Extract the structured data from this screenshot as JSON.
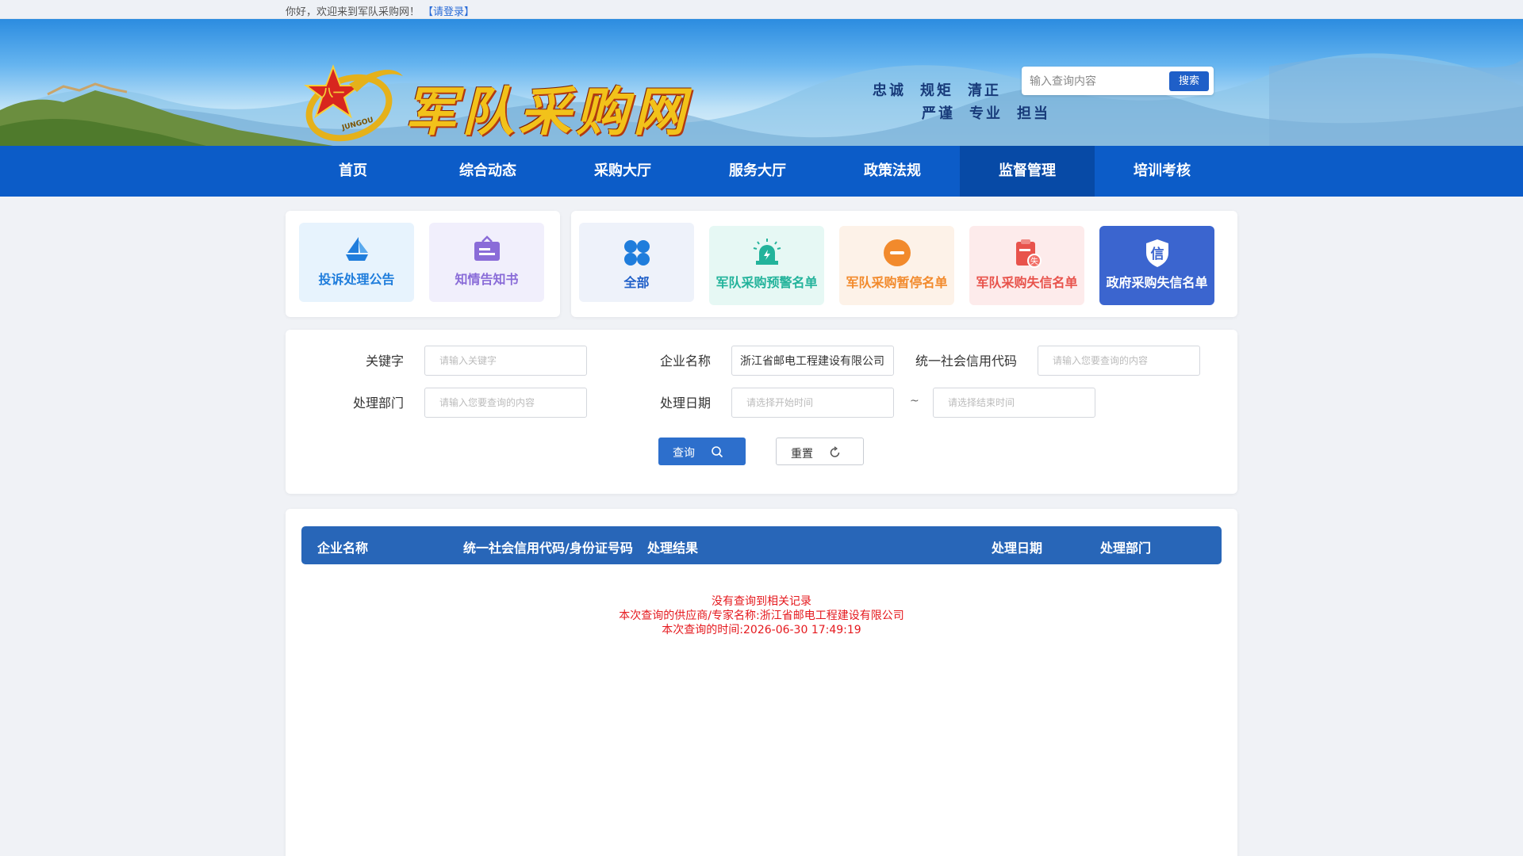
{
  "topbar": {
    "welcome": "你好，欢迎来到军队采购网！",
    "login_link": "【请登录】"
  },
  "header": {
    "site_title": "军队采购网",
    "emblem_text": "JUNGOU",
    "slogans_row1": [
      "忠诚",
      "规矩",
      "清正"
    ],
    "slogans_row2": [
      "严谨",
      "专业",
      "担当"
    ],
    "search": {
      "placeholder": "输入查询内容",
      "button": "搜索"
    }
  },
  "nav": {
    "items": [
      "首页",
      "综合动态",
      "采购大厅",
      "服务大厅",
      "政策法规",
      "监督管理",
      "培训考核"
    ],
    "active": "监督管理"
  },
  "categories_left": [
    {
      "label": "投诉处理公告",
      "icon": "complaint-icon",
      "color": "#1f7ddc",
      "bg": "#e7f3fd"
    },
    {
      "label": "知情告知书",
      "icon": "notice-board-icon",
      "color": "#8a6cd8",
      "bg": "#f1effc"
    }
  ],
  "categories_right": [
    {
      "label": "全部",
      "icon": "grid-icon",
      "color": "#1f7ddc",
      "bg": "#eef2fa"
    },
    {
      "label": "军队采购预警名单",
      "icon": "alarm-icon",
      "color": "#23b39b",
      "bg": "#e6f8f4"
    },
    {
      "label": "军队采购暂停名单",
      "icon": "pause-minus-icon",
      "color": "#f28a2c",
      "bg": "#fdf2e8"
    },
    {
      "label": "军队采购失信名单",
      "icon": "credit-loss-icon",
      "color": "#e8534c",
      "bg": "#fdebeb"
    },
    {
      "label": "政府采购失信名单",
      "icon": "credit-shield-icon",
      "color": "#ffffff",
      "bg": "#3b65cf"
    }
  ],
  "filter": {
    "keyword": {
      "label": "关键字",
      "placeholder": "请输入关键字"
    },
    "company": {
      "label": "企业名称",
      "value": "浙江省邮电工程建设有限公司"
    },
    "credit_code": {
      "label": "统一社会信用代码",
      "placeholder": "请输入您要查询的内容"
    },
    "department": {
      "label": "处理部门",
      "placeholder": "请输入您要查询的内容"
    },
    "date": {
      "label": "处理日期",
      "start_placeholder": "请选择开始时间",
      "separator": "~",
      "end_placeholder": "请选择结束时间"
    },
    "query_button": "查询",
    "reset_button": "重置"
  },
  "table": {
    "columns": [
      "企业名称",
      "统一社会信用代码/身份证号码",
      "处理结果",
      "处理日期",
      "处理部门"
    ],
    "empty_lines": [
      "没有查询到相关记录",
      "本次查询的供应商/专家名称:浙江省邮电工程建设有限公司",
      "本次查询的时间:2026-06-30 17:49:19"
    ]
  },
  "colors": {
    "nav_bg": "#0c5cc8",
    "nav_active": "#074aa6",
    "table_head": "#2866b8",
    "error_text": "#e5191e"
  }
}
